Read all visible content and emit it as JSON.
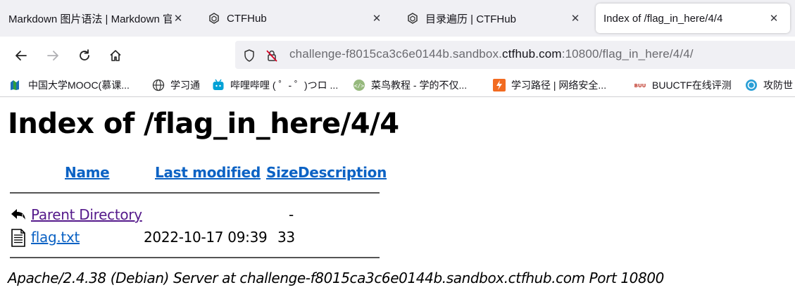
{
  "tabs": [
    {
      "title": "Markdown 图片语法 | Markdown 官",
      "icon": "markdown-icon",
      "active": false
    },
    {
      "title": "CTFHub",
      "icon": "ctfhub-icon",
      "active": false
    },
    {
      "title": "目录遍历 | CTFHub",
      "icon": "ctfhub-icon",
      "active": false
    },
    {
      "title": "Index of /flag_in_here/4/4",
      "icon": "none",
      "active": true
    }
  ],
  "urlbar": {
    "url_prefix": "challenge-f8015ca3c6e0144b.sandbox.",
    "url_host": "ctfhub.com",
    "url_suffix": ":10800/flag_in_here/4/4/"
  },
  "bookmarks": [
    {
      "label": "中国大学MOOC(慕课...",
      "icon": "mooc-icon"
    },
    {
      "label": "学习通",
      "icon": "globe-icon"
    },
    {
      "label": "哔哩哔哩 ( ゜- ゜)つロ ...",
      "icon": "bilibili-icon"
    },
    {
      "label": "菜鸟教程 - 学的不仅...",
      "icon": "runoob-icon"
    },
    {
      "label": "学习路径 | 网络安全...",
      "icon": "path-icon"
    },
    {
      "label": "BUUCTF在线评测",
      "icon": "buuctf-icon"
    },
    {
      "label": "攻防世",
      "icon": "adworld-icon"
    }
  ],
  "page": {
    "heading": "Index of /flag_in_here/4/4",
    "columns": {
      "name": "Name",
      "last_modified": "Last modified",
      "size": "Size",
      "description": "Description"
    },
    "rows": [
      {
        "name": "Parent Directory",
        "modified": "",
        "size": "-",
        "description": "",
        "icon": "back-arrow-icon"
      },
      {
        "name": "flag.txt",
        "modified": "2022-10-17 09:39",
        "size": "33",
        "description": "",
        "icon": "text-file-icon"
      }
    ],
    "footer": "Apache/2.4.38 (Debian) Server at challenge-f8015ca3c6e0144b.sandbox.ctfhub.com Port 10800"
  },
  "colors": {
    "link": "#0b62c4",
    "visited_link": "#551a8b",
    "tab_strip_bg": "#f0f0f4"
  }
}
